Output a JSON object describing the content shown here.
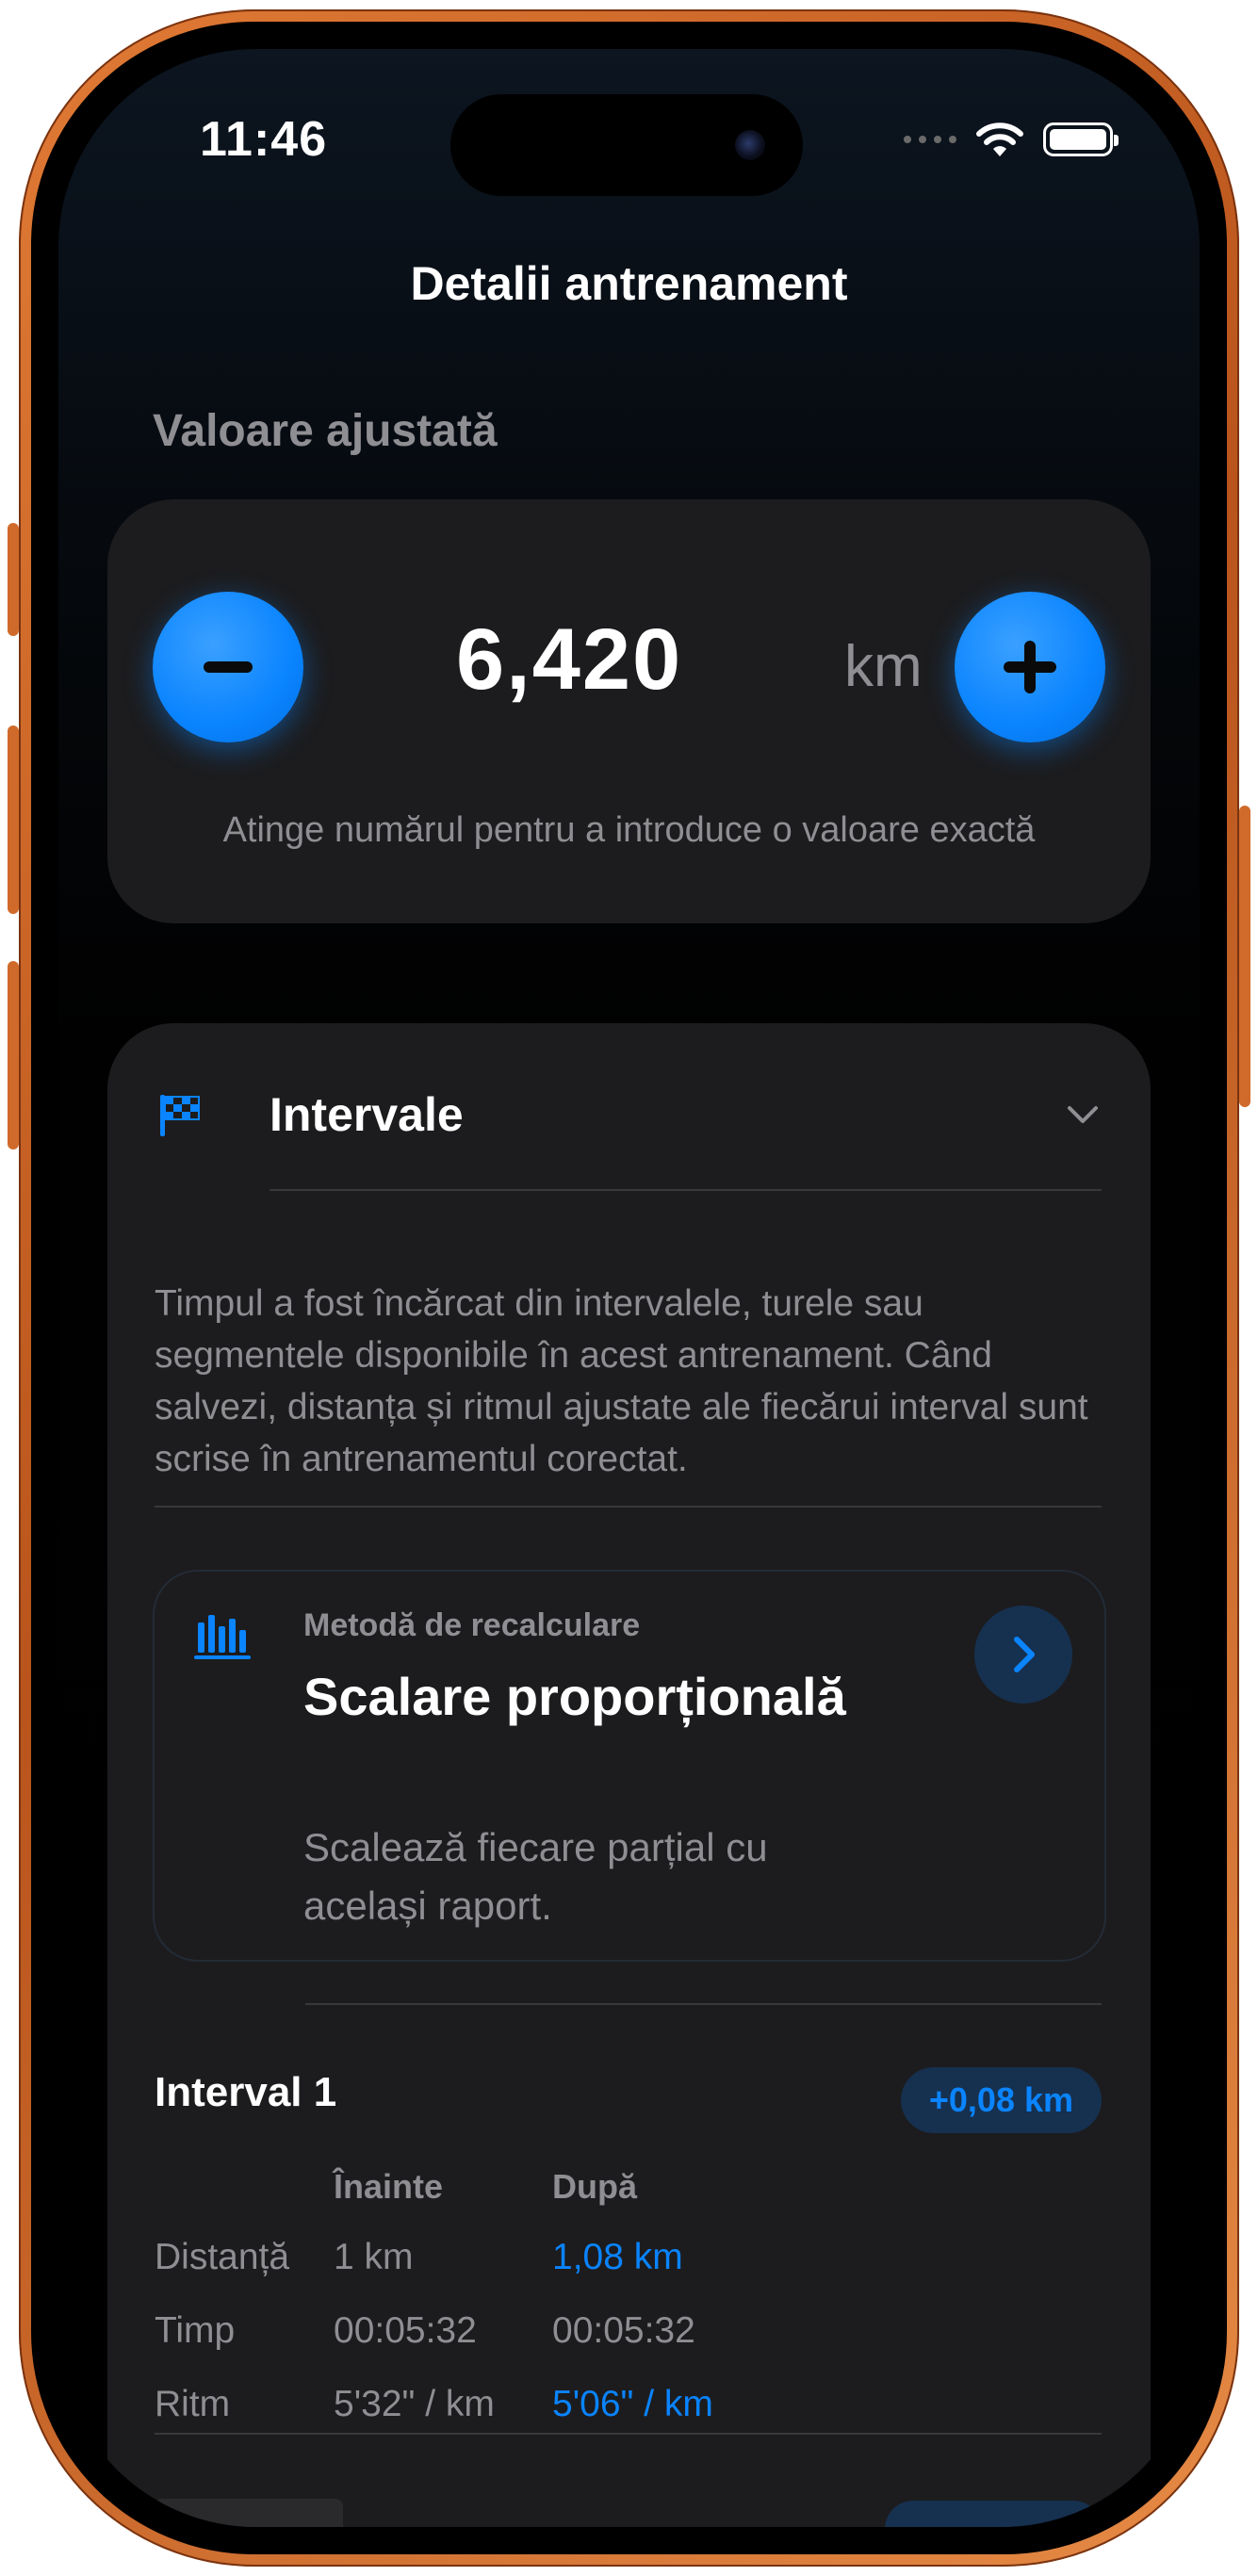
{
  "status_bar": {
    "time": "11:46",
    "wifi_icon": "wifi-icon",
    "battery_icon": "battery-icon",
    "cellular_icon": "cellular-dots-icon"
  },
  "nav": {
    "title": "Detalii antrenament"
  },
  "adjust": {
    "section_label": "Valoare ajustată",
    "value": "6,420",
    "unit": "km",
    "hint": "Atinge numărul pentru a introduce o valoare exactă",
    "minus_icon": "minus-icon",
    "plus_icon": "plus-icon"
  },
  "intervals": {
    "icon": "checkered-flag-icon",
    "title": "Intervale",
    "expand_icon": "chevron-down-icon",
    "description": "Timpul a fost încărcat din intervalele, turele sau segmentele disponibile în acest antrenament. Când salvezi, distanța și ritmul ajustate ale fiecărui interval sunt scrise în antrenamentul corectat.",
    "method": {
      "icon": "bar-chart-icon",
      "label": "Metodă de recalculare",
      "title": "Scalare proporțională",
      "subtitle": "Scalează fiecare parțial cu același raport.",
      "chevron_icon": "chevron-right-icon"
    },
    "items": [
      {
        "name": "Interval 1",
        "delta": "+0,08 km",
        "headers": {
          "before": "Înainte",
          "after": "După"
        },
        "rows": [
          {
            "label": "Distanță",
            "before": "1 km",
            "after": "1,08 km",
            "changed": true
          },
          {
            "label": "Timp",
            "before": "00:05:32",
            "after": "00:05:32",
            "changed": false
          },
          {
            "label": "Ritm",
            "before": "5'32\" / km",
            "after": "5'06\" / km",
            "changed": true
          }
        ]
      }
    ]
  },
  "colors": {
    "accent": "#0a84ff",
    "card": "#1c1c1e",
    "secondary_text": "#8e8e93",
    "frame": "#d06a2a"
  }
}
